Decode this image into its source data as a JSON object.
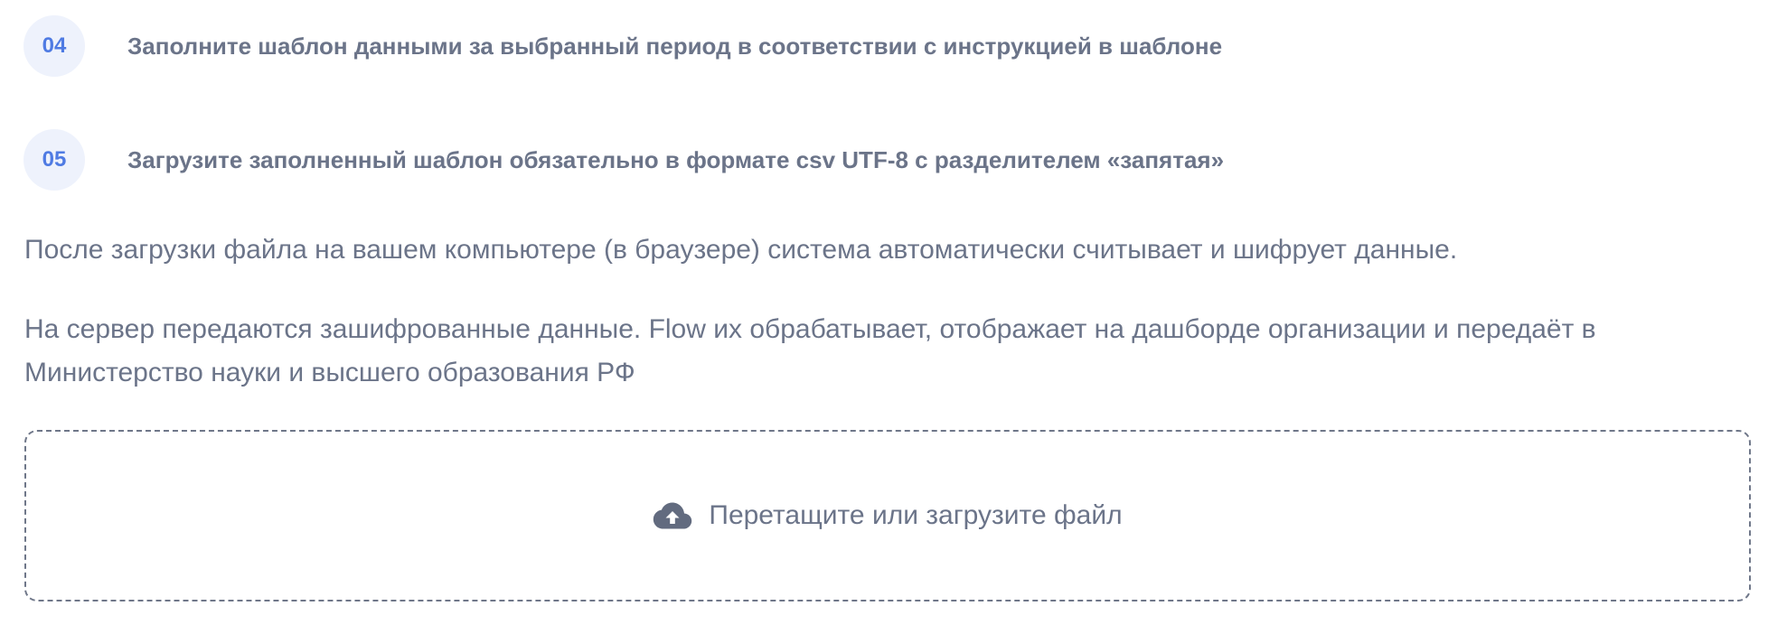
{
  "steps": [
    {
      "number": "04",
      "text": "Заполните шаблон данными за выбранный период в соответствии с инструкцией в шаблоне"
    },
    {
      "number": "05",
      "text": "Загрузите заполненный шаблон обязательно в формате csv UTF-8 с разделителем «запятая»"
    }
  ],
  "info": {
    "paragraph_1": "После загрузки файла на вашем компьютере (в браузере) система автоматически считывает и шифрует данные.",
    "paragraph_2": "На сервер передаются зашифрованные данные. Flow их обрабатывает, отображает на дашборде организации и передаёт в Министерство науки и высшего образования РФ"
  },
  "upload": {
    "icon": "cloud-upload-icon",
    "label": "Перетащите или загрузите файл"
  },
  "colors": {
    "accent": "#4f7be3",
    "badge_background": "#eef2fc",
    "text": "#6b7489",
    "border": "#6f7789"
  }
}
